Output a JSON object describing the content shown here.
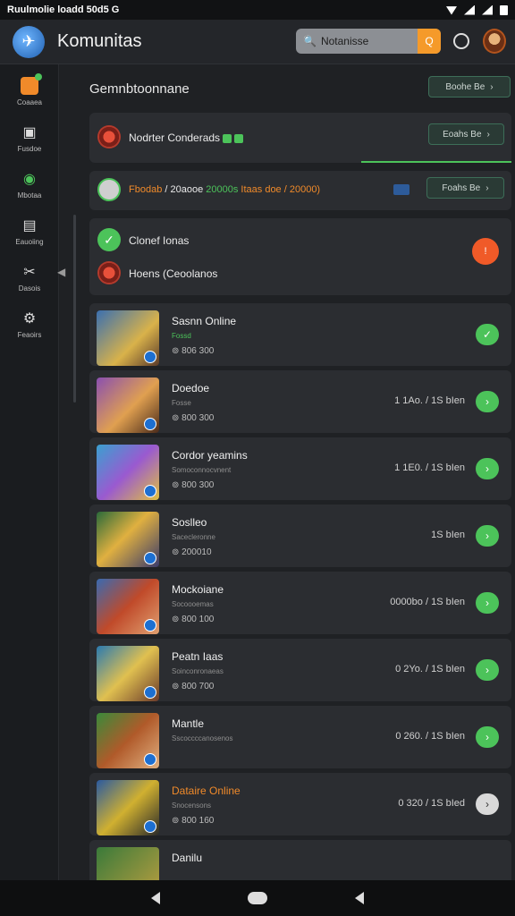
{
  "status": {
    "left": "Ruulmolie loadd 50d5 G"
  },
  "app": {
    "title": "Komunitas",
    "search_placeholder": "Notanisse",
    "search_btn": "Q"
  },
  "sidebar": {
    "items": [
      {
        "label": "Coaaea",
        "icon": "home-icon"
      },
      {
        "label": "Fusdoe",
        "icon": "frame-icon"
      },
      {
        "label": "Mbotaa",
        "icon": "compass-icon"
      },
      {
        "label": "Eauoiing",
        "icon": "briefcase-icon"
      },
      {
        "label": "Dasois",
        "icon": "tools-icon"
      },
      {
        "label": "Feaoirs",
        "icon": "gear-icon"
      }
    ]
  },
  "main": {
    "section_title": "Gemnbtoonnane",
    "top_btn": "Boohe Be",
    "card1": {
      "label": "Nodrter Conderads",
      "btn": "Eoahs Be"
    },
    "stats": {
      "part1": "Fbodab",
      "part2": "/ 20aooe",
      "part3": "20000s",
      "part4": "Itaas doe / 20000)",
      "btn": "Foahs Be"
    },
    "card3": {
      "row1": "Clonef Ionas",
      "row2": "Hoens (Ceoolanos"
    },
    "games": [
      {
        "title": "Sasnn Online",
        "sub": "Fossd",
        "players": "806 300",
        "price": "",
        "btn": "check",
        "title_color": "#f0f0f0"
      },
      {
        "title": "Doedoe",
        "sub": "Fosse",
        "players": "800 300",
        "price": "1 1Ao. / 1S bIen",
        "btn": "arrow",
        "title_color": "#f0f0f0"
      },
      {
        "title": "Cordor yeamins",
        "sub": "Somoconnocvnent",
        "players": "800 300",
        "price": "1 1E0. / 1S bIen",
        "btn": "arrow",
        "title_color": "#f0f0f0"
      },
      {
        "title": "Soslleo",
        "sub": "Sacecleronne",
        "players": "200010",
        "price": "1S bIen",
        "btn": "arrow",
        "title_color": "#f0f0f0"
      },
      {
        "title": "Mockoiane",
        "sub": "Socoooemas",
        "players": "800 100",
        "price": "0000bo / 1S bIen",
        "btn": "arrow",
        "title_color": "#f0f0f0"
      },
      {
        "title": "Peatn Iaas",
        "sub": "Soinconronaeas",
        "players": "800 700",
        "price": "0 2Yo. / 1S bIen",
        "btn": "arrow",
        "title_color": "#f0f0f0"
      },
      {
        "title": "Mantle",
        "sub": "Sscoccccanosenos",
        "players": "",
        "price": "0 260. / 1S bIen",
        "btn": "arrow",
        "title_color": "#f0f0f0"
      },
      {
        "title": "Dataire Online",
        "sub": "Snocensons",
        "players": "800 160",
        "price": "0 320 / 1S bIed",
        "btn": "arrow-grey",
        "title_color": "#f08a2a"
      },
      {
        "title": "Danilu",
        "sub": "",
        "players": "",
        "price": "",
        "btn": "none",
        "title_color": "#f0f0f0"
      }
    ]
  },
  "colors": {
    "accent_green": "#4cc35a",
    "accent_orange": "#f08a2a",
    "bg": "#1f2124",
    "card": "#2b2d31"
  }
}
